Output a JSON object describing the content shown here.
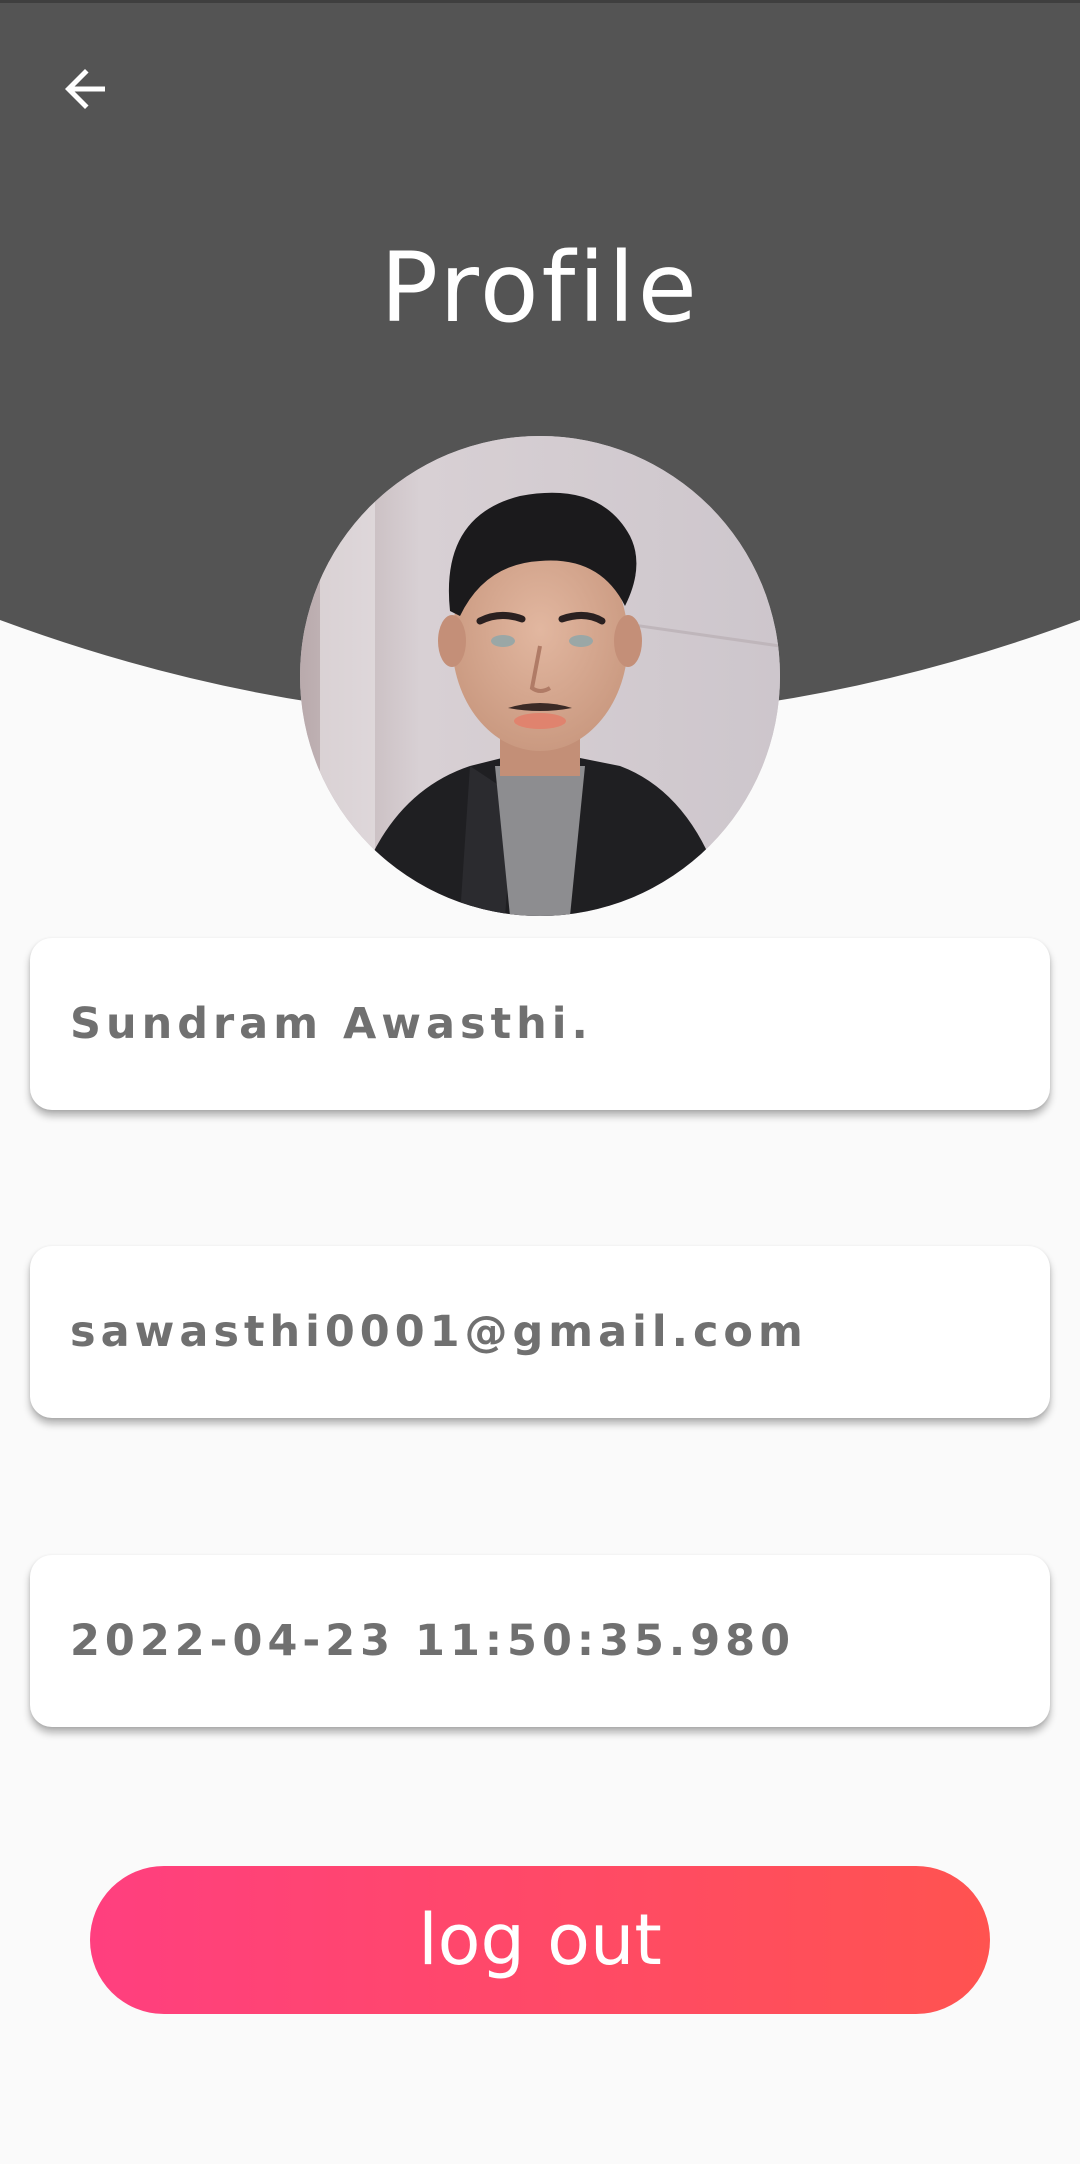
{
  "header": {
    "title": "Profile",
    "background_color": "#545454",
    "back_icon": "arrow-left-icon"
  },
  "profile": {
    "avatar_alt": "profile photo",
    "name": "Sundram Awasthi.",
    "email": "sawasthi0001@gmail.com",
    "timestamp": "2022-04-23 11:50:35.980"
  },
  "actions": {
    "logout_label": "log out",
    "logout_gradient": [
      "#ff3f7f",
      "#ff5350"
    ]
  }
}
